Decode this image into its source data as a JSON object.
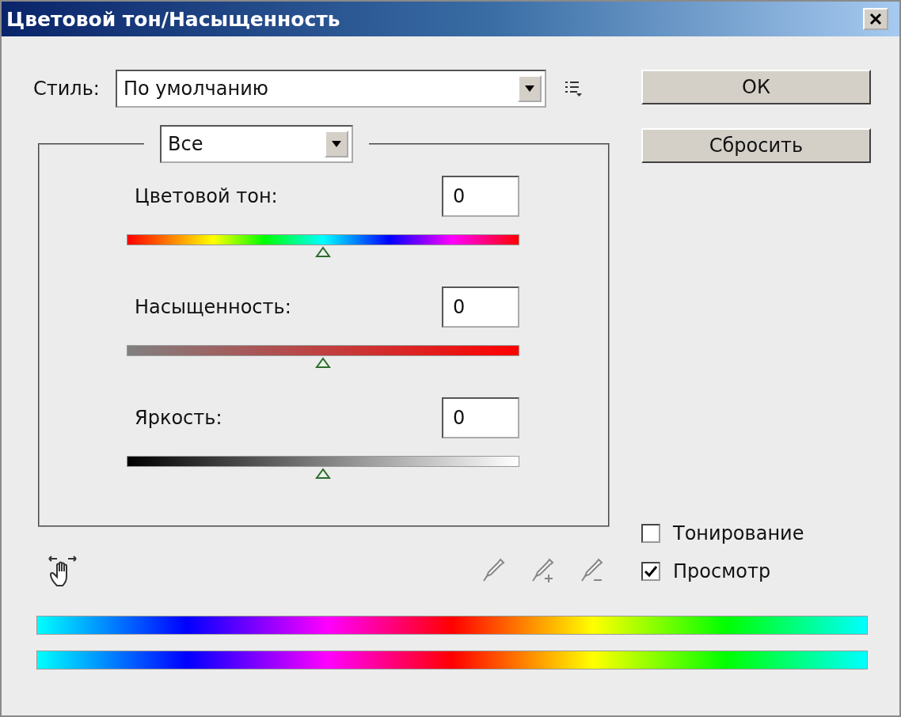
{
  "window": {
    "title": "Цветовой тон/Насыщенность"
  },
  "style": {
    "label": "Стиль:",
    "value": "По умолчанию"
  },
  "buttons": [
    {
      "label": "ОК"
    },
    {
      "label": "Сбросить"
    }
  ],
  "channel": {
    "value": "Все"
  },
  "sliders": [
    {
      "kind": "hue",
      "label": "Цветовой тон:",
      "value": "0",
      "level": 0.5
    },
    {
      "kind": "saturation",
      "label": "Насыщенность:",
      "value": "0",
      "level": 0.5
    },
    {
      "kind": "lightness",
      "label": "Яркость:",
      "value": "0",
      "level": 0.5
    }
  ],
  "tools": [
    {
      "kind": "eyedropper",
      "disabled": true
    },
    {
      "kind": "eyedropper-plus",
      "disabled": true
    },
    {
      "kind": "eyedropper-minus",
      "disabled": true
    }
  ],
  "options": [
    {
      "label": "Тонирование",
      "checked": false
    },
    {
      "label": "Просмотр",
      "checked": true
    }
  ]
}
